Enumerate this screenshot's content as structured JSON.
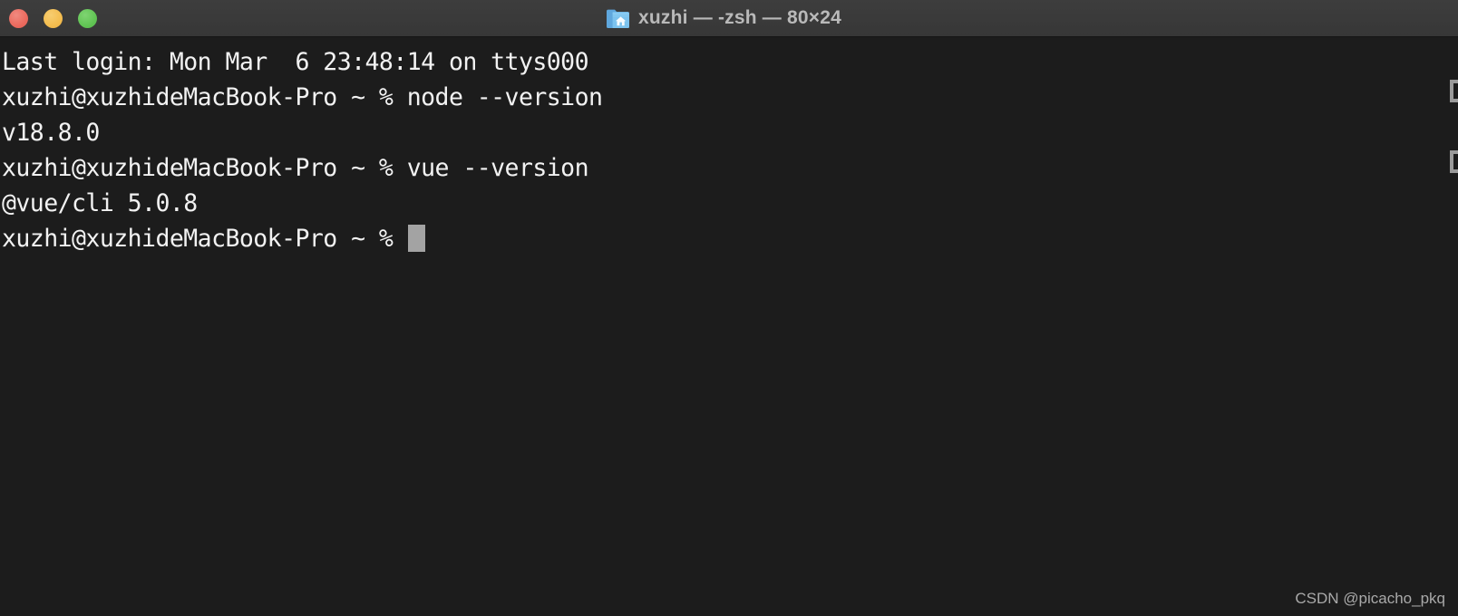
{
  "window": {
    "titlebar": {
      "title": "xuzhi — -zsh — 80×24",
      "icon_name": "home-folder-icon",
      "buttons": {
        "close_label": "",
        "minimize_label": "",
        "maximize_label": ""
      },
      "colors": {
        "background": "#3a3a3a",
        "title_text": "#b9b9b9",
        "close": "#eb6a5e",
        "minimize": "#f4bd4f",
        "maximize": "#61c454"
      }
    },
    "terminal": {
      "colors": {
        "background": "#1c1c1c",
        "foreground": "#f2f2f2",
        "cursor": "#a3a3a3"
      },
      "size": "80×24",
      "lines": [
        "Last login: Mon Mar  6 23:48:14 on ttys000",
        "xuzhi@xuzhideMacBook-Pro ~ % node --version",
        "v18.8.0",
        "xuzhi@xuzhideMacBook-Pro ~ % vue --version",
        "@vue/cli 5.0.8",
        "xuzhi@xuzhideMacBook-Pro ~ % "
      ],
      "prompt": "xuzhi@xuzhideMacBook-Pro ~ % ",
      "commands": [
        {
          "command": "node --version",
          "output": "v18.8.0"
        },
        {
          "command": "vue --version",
          "output": "@vue/cli 5.0.8"
        }
      ],
      "cursor_visible": true
    },
    "watermark": "CSDN @picacho_pkq"
  }
}
